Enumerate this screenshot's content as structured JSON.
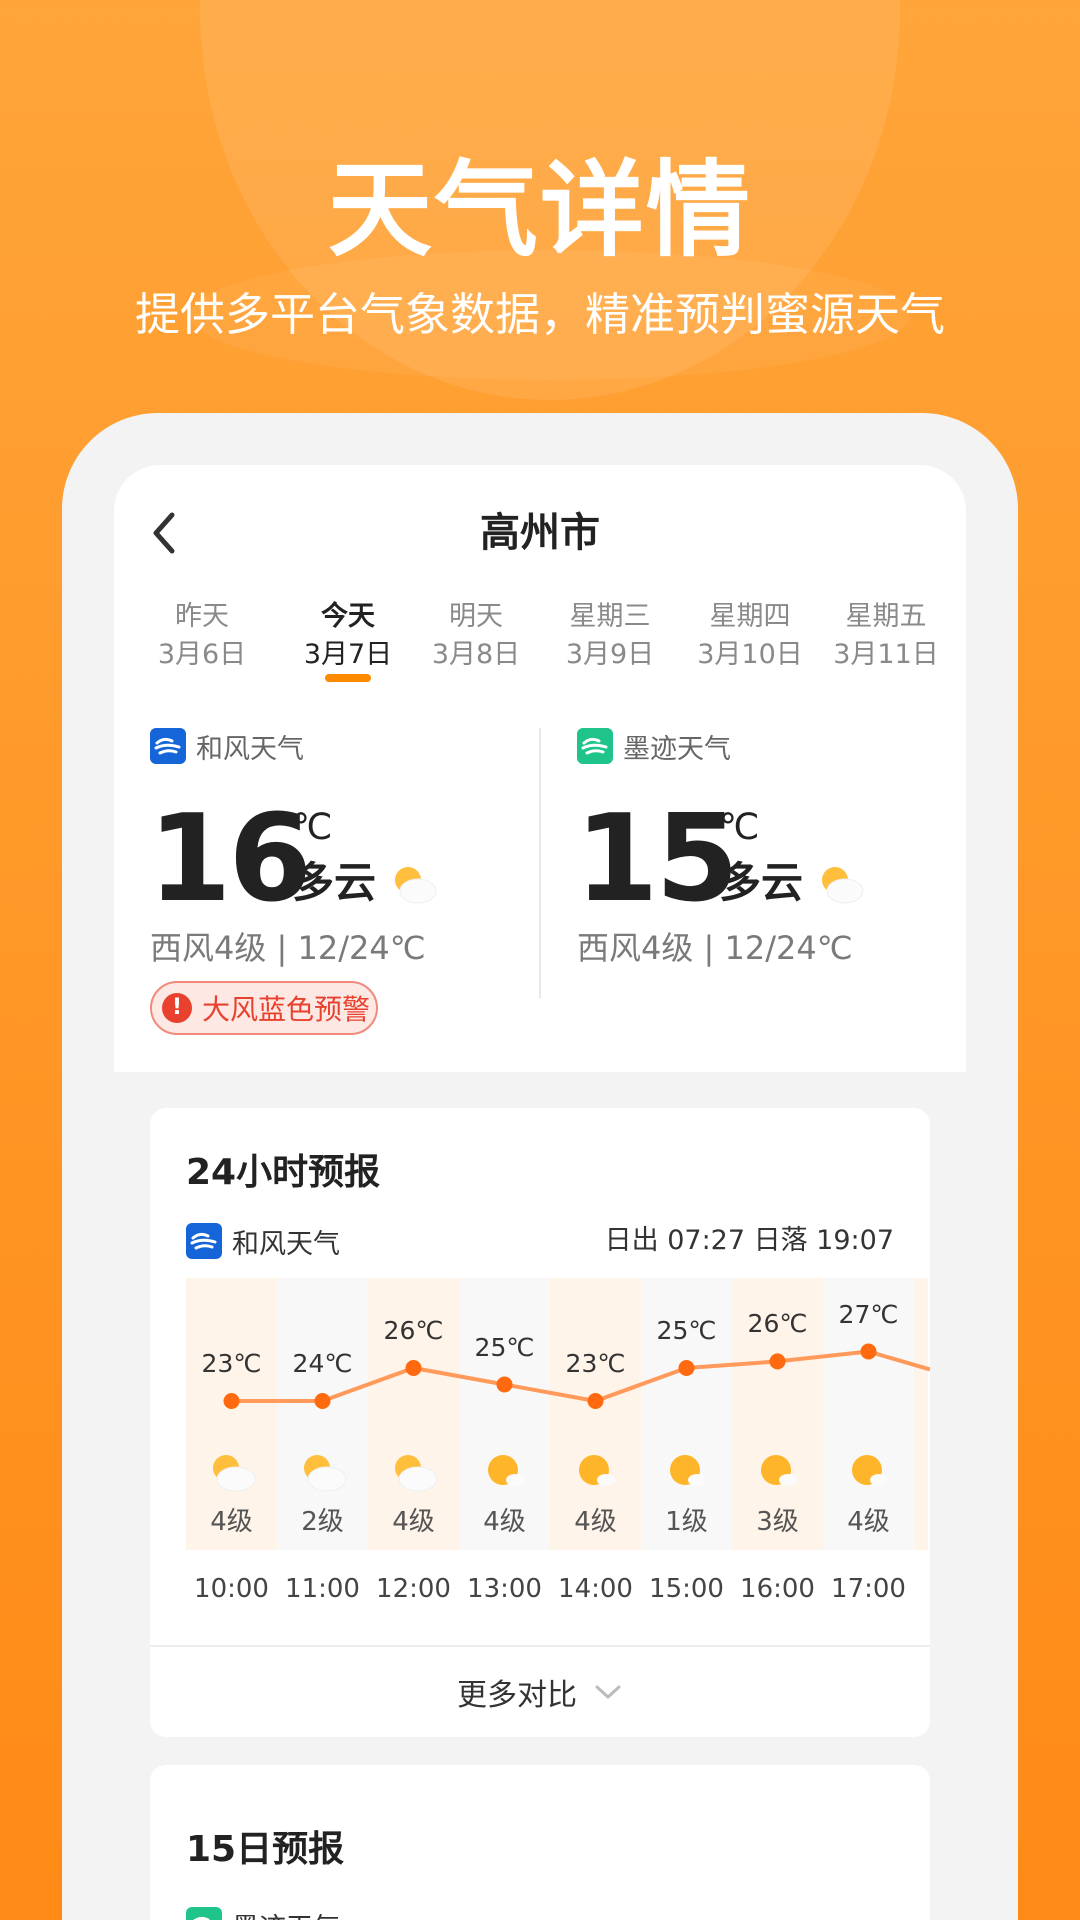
{
  "hero": {
    "title": "天气详情",
    "subtitle": "提供多平台气象数据，精准预判蜜源天气"
  },
  "header": {
    "city": "高州市"
  },
  "day_tabs": [
    {
      "name": "昨天",
      "date": "3月6日"
    },
    {
      "name": "今天",
      "date": "3月7日",
      "active": true
    },
    {
      "name": "明天",
      "date": "3月8日"
    },
    {
      "name": "星期三",
      "date": "3月9日"
    },
    {
      "name": "星期四",
      "date": "3月10日"
    },
    {
      "name": "星期五",
      "date": "3月11日"
    }
  ],
  "providers": [
    {
      "name": "和风天气",
      "temp": "16",
      "unit": "℃",
      "condition": "多云",
      "wind_range": "西风4级 | 12/24℃",
      "alert": "大风蓝色预警"
    },
    {
      "name": "墨迹天气",
      "temp": "15",
      "unit": "℃",
      "condition": "多云",
      "wind_range": "西风4级 | 12/24℃"
    }
  ],
  "forecast24": {
    "title": "24小时预报",
    "provider": "和风天气",
    "sun_times": "日出 07:27 日落 19:07",
    "more_label": "更多对比",
    "hours": [
      {
        "time": "10:00",
        "temp": "23℃",
        "temp_value": 23,
        "wind": "4级",
        "icon": "partly-cloudy-icon"
      },
      {
        "time": "11:00",
        "temp": "24℃",
        "temp_value": 23,
        "wind": "2级",
        "icon": "partly-cloudy-icon"
      },
      {
        "time": "12:00",
        "temp": "26℃",
        "temp_value": 25,
        "wind": "4级",
        "icon": "partly-cloudy-icon"
      },
      {
        "time": "13:00",
        "temp": "25℃",
        "temp_value": 24,
        "wind": "4级",
        "icon": "sunny-icon"
      },
      {
        "time": "14:00",
        "temp": "23℃",
        "temp_value": 23,
        "wind": "4级",
        "icon": "sunny-icon"
      },
      {
        "time": "15:00",
        "temp": "25℃",
        "temp_value": 25,
        "wind": "1级",
        "icon": "sunny-icon"
      },
      {
        "time": "16:00",
        "temp": "26℃",
        "temp_value": 25.4,
        "wind": "3级",
        "icon": "sunny-icon"
      },
      {
        "time": "17:00",
        "temp": "27℃",
        "temp_value": 26,
        "wind": "4级",
        "icon": "sunny-icon"
      }
    ]
  },
  "forecast15": {
    "title": "15日预报",
    "provider": "墨迹天气"
  },
  "colors": {
    "accent": "#ff8a00",
    "line": "#ff9a5a",
    "dot": "#ff6a10",
    "alert": "#e8422f"
  }
}
